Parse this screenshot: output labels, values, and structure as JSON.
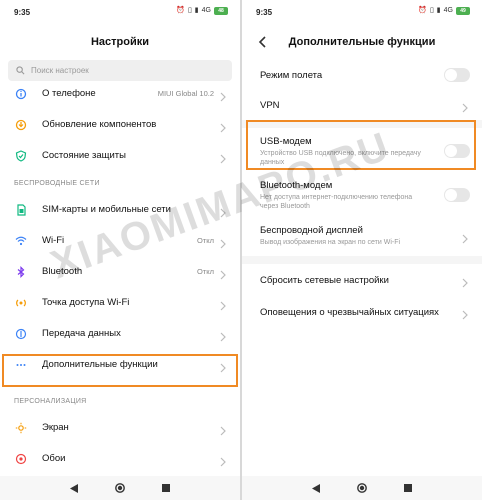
{
  "status": {
    "time_left": "9:35",
    "time_right": "9:35",
    "network": "4G",
    "battery_left": "48",
    "battery_right": "49"
  },
  "left": {
    "title": "Настройки",
    "search_placeholder": "Поиск настроек",
    "items_top": [
      {
        "label": "О телефоне",
        "value": "MIUI Global 10.2",
        "icon": "phone-icon",
        "color": "#3b82f6"
      },
      {
        "label": "Обновление компонентов",
        "value": "",
        "icon": "update-icon",
        "color": "#f59e0b"
      },
      {
        "label": "Состояние защиты",
        "value": "",
        "icon": "shield-icon",
        "color": "#10b981"
      }
    ],
    "section_wireless": "БЕСПРОВОДНЫЕ СЕТИ",
    "items_wireless": [
      {
        "label": "SIM-карты и мобильные сети",
        "value": "",
        "icon": "sim-icon",
        "color": "#10b981"
      },
      {
        "label": "Wi-Fi",
        "value": "Откл",
        "icon": "wifi-icon",
        "color": "#3b82f6"
      },
      {
        "label": "Bluetooth",
        "value": "Откл",
        "icon": "bluetooth-icon",
        "color": "#7c3aed"
      },
      {
        "label": "Точка доступа Wi-Fi",
        "value": "",
        "icon": "hotspot-icon",
        "color": "#f59e0b"
      },
      {
        "label": "Передача данных",
        "value": "",
        "icon": "data-icon",
        "color": "#3b82f6"
      },
      {
        "label": "Дополнительные функции",
        "value": "",
        "icon": "more-icon",
        "color": "#3b82f6"
      }
    ],
    "section_personal": "ПЕРСОНАЛИЗАЦИЯ",
    "items_personal": [
      {
        "label": "Экран",
        "value": "",
        "icon": "screen-icon",
        "color": "#f59e0b"
      },
      {
        "label": "Обои",
        "value": "",
        "icon": "wallpaper-icon",
        "color": "#ef4444"
      }
    ]
  },
  "right": {
    "title": "Дополнительные функции",
    "airplane": {
      "label": "Режим полета"
    },
    "vpn": {
      "label": "VPN"
    },
    "usb": {
      "label": "USB-модем",
      "sub": "Устройство USB подключено, включите передачу данных"
    },
    "bt_modem": {
      "label": "Bluetooth-модем",
      "sub": "Нет доступа интернет-подключению телефона через Bluetooth"
    },
    "wireless_display": {
      "label": "Беспроводной дисплей",
      "sub": "Вывод изображения на экран по сети Wi-Fi"
    },
    "reset": {
      "label": "Сбросить сетевые настройки"
    },
    "emergency": {
      "label": "Оповещения о чрезвычайных ситуациях"
    }
  },
  "watermark": "XIAOMIMAPO.RU",
  "colors": {
    "highlight": "#f08a24",
    "toggle_off": "#e6e6e6"
  }
}
